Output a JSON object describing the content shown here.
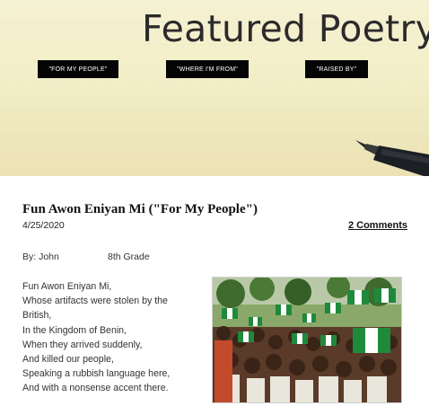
{
  "banner": {
    "title": "Featured Poetry",
    "nav": [
      {
        "label": "\"FOR MY PEOPLE\""
      },
      {
        "label": "\"WHERE I'M FROM\""
      },
      {
        "label": "\"RAISED BY\""
      }
    ]
  },
  "post": {
    "title": "Fun Awon Eniyan Mi (\"For My People\")",
    "date": "4/25/2020",
    "comments": "2 Comments",
    "author": "By: John",
    "grade": "8th Grade",
    "poem_lines": [
      "Fun Awon Eniyan Mi,",
      "Whose artifacts were stolen by the",
      "British,",
      "In the Kingdom of Benin,",
      "When they arrived suddenly,",
      "And killed our people,",
      "Speaking a rubbish language here,",
      "And with a nonsense accent there."
    ]
  },
  "colors": {
    "nav_bg": "#050505",
    "flag_green": "#1f8a3c",
    "flag_white": "#ffffff"
  }
}
